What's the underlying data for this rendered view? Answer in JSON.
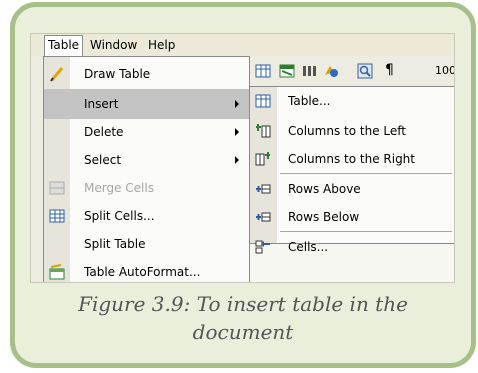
{
  "menubar": {
    "items": [
      {
        "label": "Table",
        "active": true
      },
      {
        "label": "Window",
        "active": false
      },
      {
        "label": "Help",
        "active": false
      }
    ]
  },
  "toolbar": {
    "zoom": "100"
  },
  "table_menu": {
    "items": [
      {
        "label": "Draw Table",
        "icon": "pencil-icon",
        "submenu": false,
        "disabled": false
      },
      {
        "label": "Insert",
        "icon": "",
        "submenu": true,
        "disabled": false,
        "highlighted": true
      },
      {
        "label": "Delete",
        "icon": "",
        "submenu": true,
        "disabled": false
      },
      {
        "label": "Select",
        "icon": "",
        "submenu": true,
        "disabled": false
      },
      {
        "label": "Merge Cells",
        "icon": "merge-cells-icon",
        "submenu": false,
        "disabled": true
      },
      {
        "label": "Split Cells...",
        "icon": "split-cells-icon",
        "submenu": false,
        "disabled": false
      },
      {
        "label": "Split Table",
        "icon": "",
        "submenu": false,
        "disabled": false
      },
      {
        "label": "Table AutoFormat...",
        "icon": "autoformat-icon",
        "submenu": false,
        "disabled": false
      }
    ]
  },
  "insert_submenu": {
    "items": [
      {
        "label": "Table...",
        "icon": "table-icon"
      },
      {
        "label": "Columns to the Left",
        "icon": "columns-left-icon"
      },
      {
        "label": "Columns to the Right",
        "icon": "columns-right-icon"
      },
      {
        "label": "Rows Above",
        "icon": "rows-above-icon"
      },
      {
        "label": "Rows Below",
        "icon": "rows-below-icon"
      },
      {
        "label": "Cells...",
        "icon": "cells-icon"
      }
    ]
  },
  "caption": {
    "line1": "Figure 3.9: To insert table in the",
    "line2": "document"
  },
  "colors": {
    "frame_border": "#a7c08a",
    "frame_fill": "#e9efdb",
    "highlight": "#c3c3c3",
    "caption_text": "#555555"
  }
}
